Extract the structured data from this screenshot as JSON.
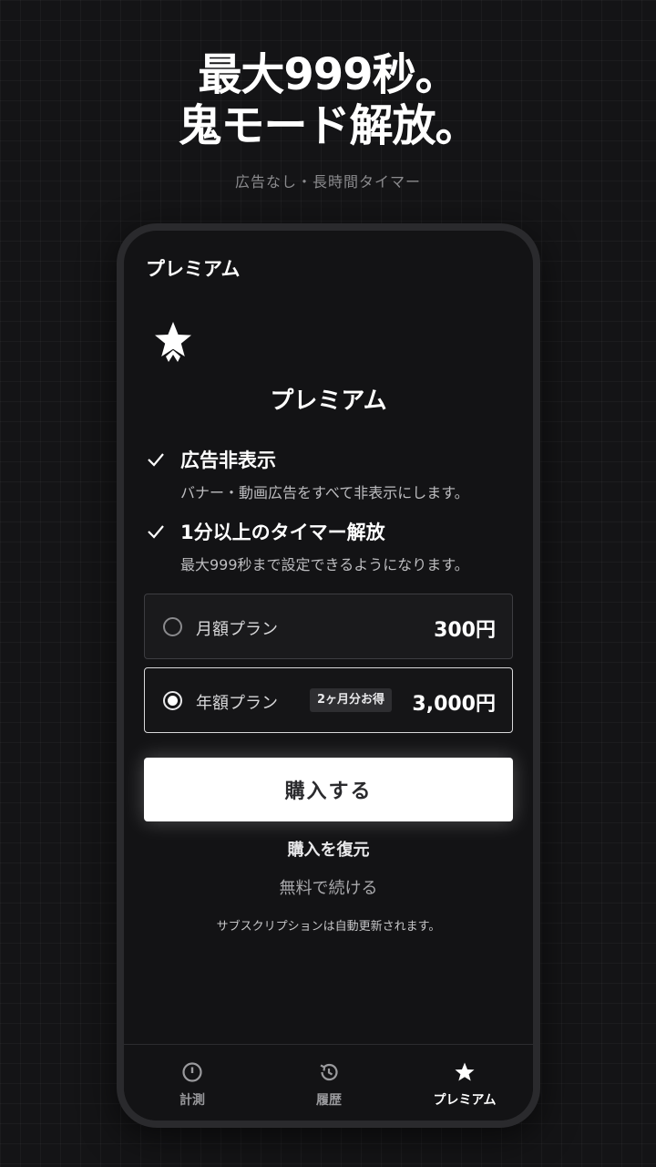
{
  "promo": {
    "headline_line1": "最大999秒。",
    "headline_line2": "鬼モード解放。",
    "subheadline": "広告なし・長時間タイマー"
  },
  "app": {
    "title": "プレミアム",
    "heading": "プレミアム",
    "features": [
      {
        "title": "広告非表示",
        "description": "バナー・動画広告をすべて非表示にします。"
      },
      {
        "title": "1分以上のタイマー解放",
        "description": "最大999秒まで設定できるようになります。"
      }
    ],
    "plans": [
      {
        "name": "月額プラン",
        "price": "300円",
        "selected": false
      },
      {
        "name": "年額プラン",
        "price": "3,000円",
        "badge": "2ヶ月分お得",
        "selected": true
      }
    ],
    "buy_button": "購入する",
    "restore_link": "購入を復元",
    "continue_free_link": "無料で続ける",
    "subscription_note": "サブスクリプションは自動更新されます。"
  },
  "tabbar": {
    "tabs": [
      {
        "label": "計測",
        "icon": "timer-icon",
        "active": false
      },
      {
        "label": "履歴",
        "icon": "history-icon",
        "active": false
      },
      {
        "label": "プレミアム",
        "icon": "star-icon",
        "active": true
      }
    ]
  },
  "colors": {
    "background": "#141416",
    "screen": "#131315",
    "accent": "#ffffff"
  }
}
